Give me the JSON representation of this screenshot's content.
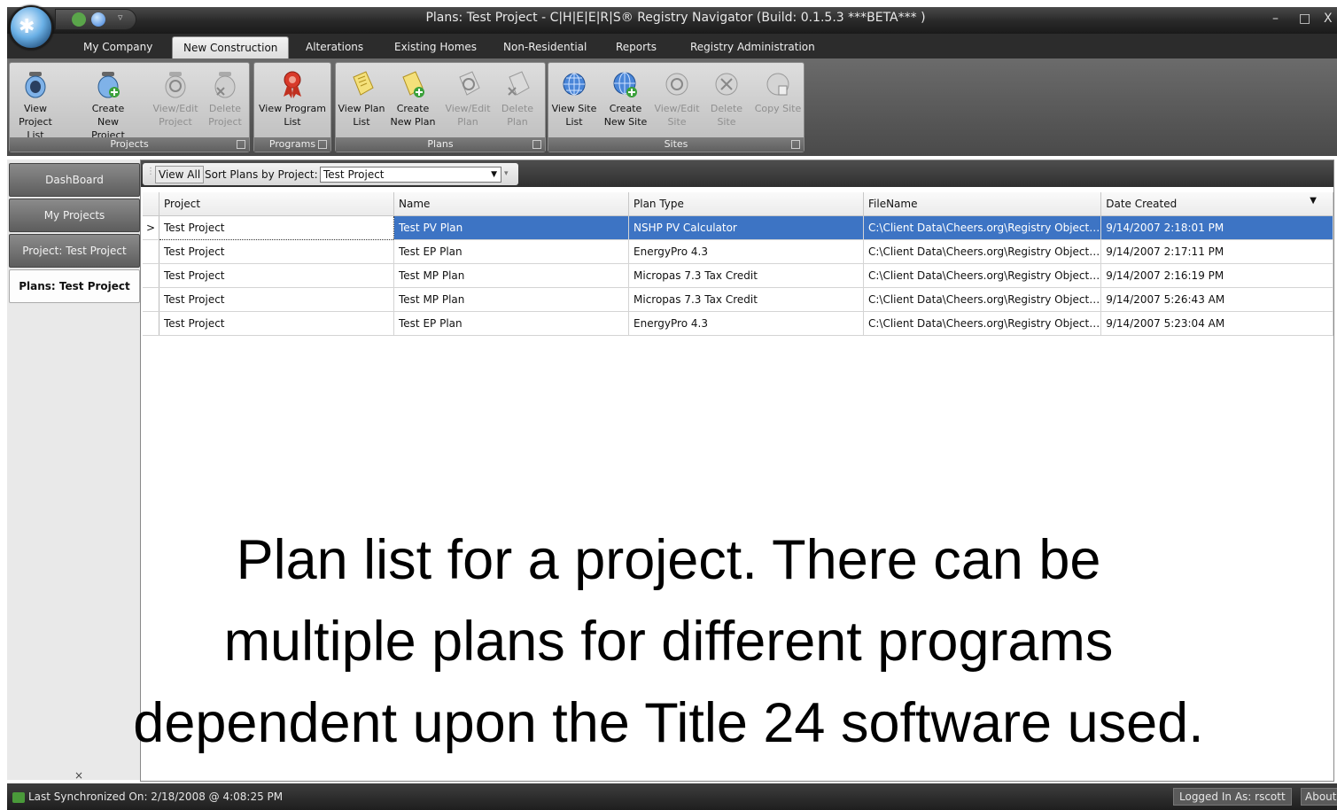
{
  "window": {
    "title": "Plans: Test Project - C|H|E|E|R|S® Registry Navigator (Build: 0.1.5.3 ***BETA*** )",
    "minimize": "–",
    "restore": "□",
    "close": "X"
  },
  "tabs": [
    "My Company",
    "New Construction",
    "Alterations",
    "Existing Homes",
    "Non-Residential",
    "Reports",
    "Registry Administration"
  ],
  "ribbon": {
    "projects": {
      "label": "Projects",
      "buttons": [
        {
          "line1": "View Project",
          "line2": "List"
        },
        {
          "line1": "Create New",
          "line2": "Project"
        },
        {
          "line1": "View/Edit",
          "line2": "Project"
        },
        {
          "line1": "Delete",
          "line2": "Project"
        }
      ]
    },
    "programs": {
      "label": "Programs",
      "buttons": [
        {
          "line1": "View Program",
          "line2": "List"
        }
      ]
    },
    "plans": {
      "label": "Plans",
      "buttons": [
        {
          "line1": "View Plan",
          "line2": "List"
        },
        {
          "line1": "Create",
          "line2": "New Plan"
        },
        {
          "line1": "View/Edit",
          "line2": "Plan"
        },
        {
          "line1": "Delete",
          "line2": "Plan"
        }
      ]
    },
    "sites": {
      "label": "Sites",
      "buttons": [
        {
          "line1": "View Site",
          "line2": "List"
        },
        {
          "line1": "Create",
          "line2": "New Site"
        },
        {
          "line1": "View/Edit",
          "line2": "Site"
        },
        {
          "line1": "Delete",
          "line2": "Site"
        },
        {
          "line1": "Copy Site",
          "line2": ""
        }
      ]
    }
  },
  "nav": {
    "items": [
      "DashBoard",
      "My Projects",
      "Project: Test Project",
      "Plans: Test Project"
    ],
    "close": "×"
  },
  "toolbar": {
    "view_all": "View All",
    "sort_label": "Sort Plans by Project:",
    "sort_value": "Test Project"
  },
  "grid": {
    "columns": [
      "Project",
      "Name",
      "Plan Type",
      "FileName",
      "Date Created"
    ],
    "rows": [
      [
        "Test Project",
        "Test PV Plan",
        "NSHP PV Calculator",
        "C:\\Client Data\\Cheers.org\\Registry Object…",
        "9/14/2007 2:18:01 PM"
      ],
      [
        "Test Project",
        "Test EP Plan",
        "EnergyPro 4.3",
        "C:\\Client Data\\Cheers.org\\Registry Object…",
        "9/14/2007 2:17:11 PM"
      ],
      [
        "Test Project",
        "Test MP Plan",
        "Micropas 7.3 Tax Credit",
        "C:\\Client Data\\Cheers.org\\Registry Object…",
        "9/14/2007 2:16:19 PM"
      ],
      [
        "Test Project",
        "Test MP Plan",
        "Micropas 7.3 Tax Credit",
        "C:\\Client Data\\Cheers.org\\Registry Object…",
        "9/14/2007 5:26:43 AM"
      ],
      [
        "Test Project",
        "Test EP Plan",
        "EnergyPro 4.3",
        "C:\\Client Data\\Cheers.org\\Registry Object…",
        "9/14/2007 5:23:04 AM"
      ]
    ]
  },
  "caption": {
    "line1": "Plan list for a project.  There can be",
    "line2": "multiple plans for different programs",
    "line3": "dependent upon the Title 24 software used."
  },
  "status": {
    "sync": "Last Synchronized On: 2/18/2008 @ 4:08:25 PM",
    "logged_in": "Logged In As: rscott",
    "about": "About"
  },
  "colors": {
    "selection": "#3d74c4",
    "titlebar": "#2a2a2a"
  }
}
